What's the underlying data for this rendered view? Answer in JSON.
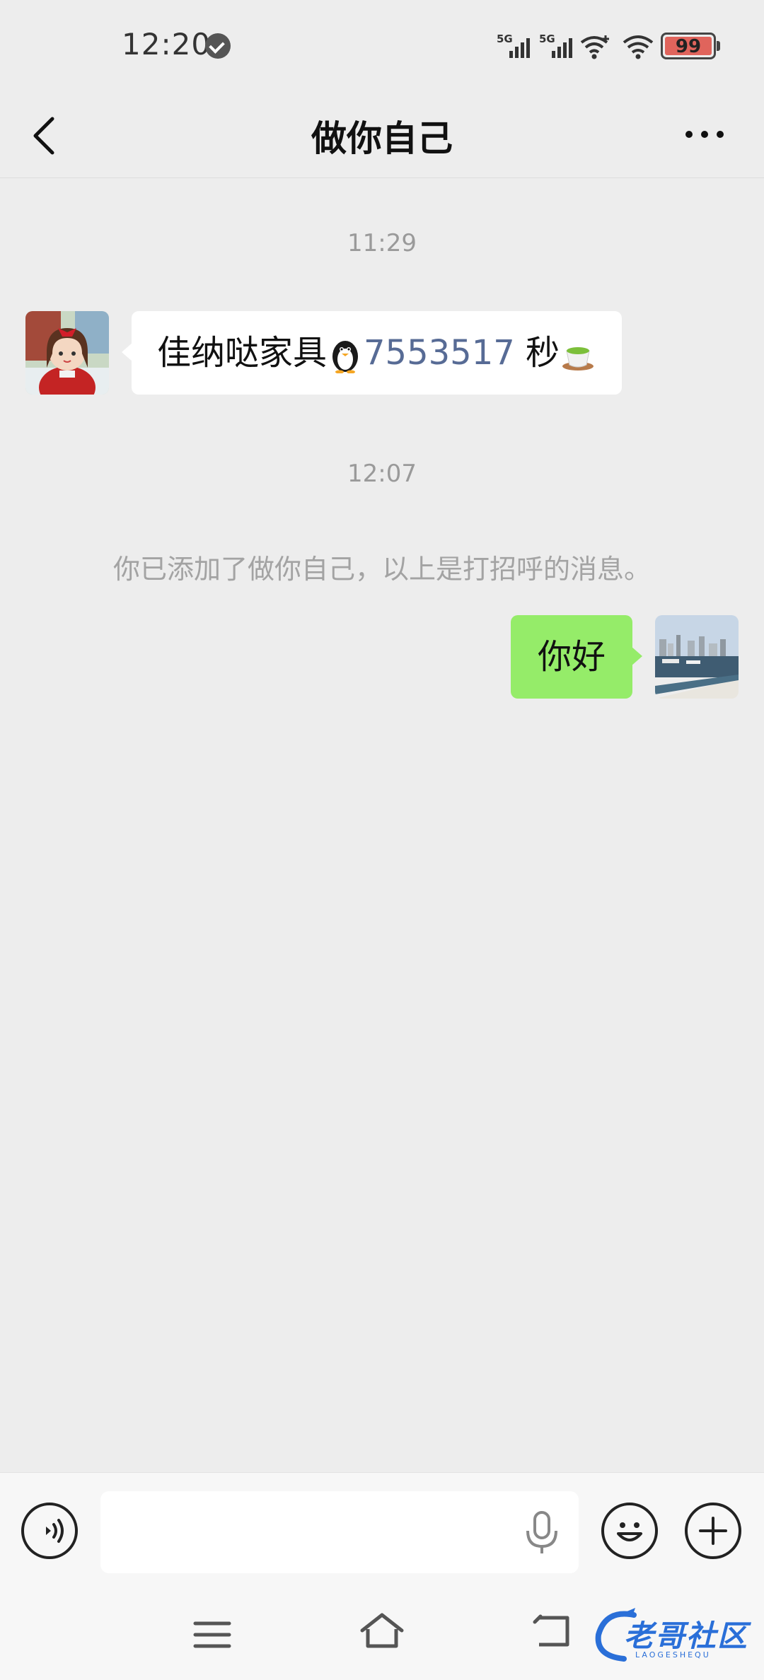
{
  "status_bar": {
    "time": "12:20",
    "signal1_label": "5G",
    "signal2_label": "5G",
    "battery_level": "99"
  },
  "header": {
    "title": "做你自己"
  },
  "chat": {
    "messages": [
      {
        "type": "time",
        "text": "11:29"
      },
      {
        "type": "incoming",
        "text_prefix": "佳纳哒家具",
        "emoji1": "penguin-emoji",
        "number": "7553517",
        "text_suffix": " 秒",
        "emoji2": "tea-emoji"
      },
      {
        "type": "time",
        "text": "12:07"
      },
      {
        "type": "system",
        "text": "你已添加了做你自己，以上是打招呼的消息。"
      },
      {
        "type": "outgoing",
        "text": "你好"
      }
    ]
  },
  "input_bar": {
    "value": "",
    "voice_icon": "voice-icon",
    "mic_icon": "mic-icon",
    "emoji_icon": "smiley-icon",
    "plus_icon": "plus-icon"
  },
  "watermark": {
    "text": "老哥社区",
    "sub": "LAOGESHEQU"
  },
  "colors": {
    "background": "#ededed",
    "outgoing_bubble": "#95ec69",
    "incoming_bubble": "#ffffff",
    "link_number": "#576b95",
    "muted_text": "#9a9a9a"
  }
}
